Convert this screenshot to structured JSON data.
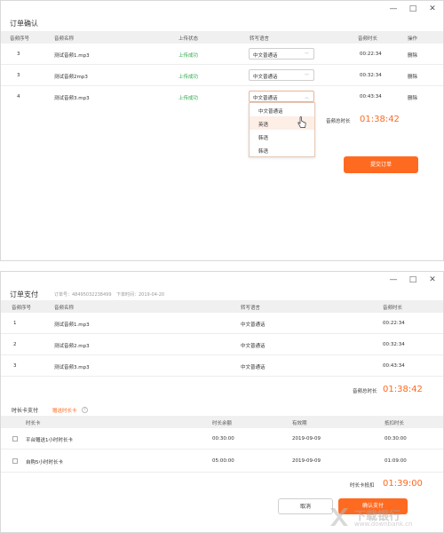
{
  "window_controls": {
    "minimize": "—",
    "maximize": "□",
    "close": "✕"
  },
  "order_confirm": {
    "title": "订单确认",
    "headers": [
      "音频序号",
      "音频名称",
      "上传状态",
      "转写语言",
      "音频时长",
      "操作"
    ],
    "rows": [
      {
        "index": "3",
        "name": "测试音频1.mp3",
        "status": "上传成功",
        "language": "中文普通话",
        "duration": "00:22:34",
        "action": "删除"
      },
      {
        "index": "3",
        "name": "测试音频2mp3",
        "status": "上传成功",
        "language": "中文普通话",
        "duration": "00:32:34",
        "action": "删除"
      },
      {
        "index": "4",
        "name": "测试音频3.mp3",
        "status": "上传成功",
        "language": "中文普通话",
        "duration": "00:43:34",
        "action": "删除"
      }
    ],
    "dropdown_options": [
      "中文普通话",
      "英语",
      "韩语",
      "韩语"
    ],
    "highlighted_option": 1,
    "total_label": "音频总时长",
    "total_value": "01:38:42",
    "submit_label": "提交订单"
  },
  "order_pay": {
    "title": "订单支付",
    "order_no": "订单号：48495032238499",
    "order_time": "下单时间：2019-04-20",
    "headers": [
      "音频序号",
      "音频名称",
      "转写语言",
      "音频时长"
    ],
    "rows": [
      {
        "index": "1",
        "name": "测试音频1.mp3",
        "language": "中文普通话",
        "duration": "00:22:34"
      },
      {
        "index": "2",
        "name": "测试音频2.mp3",
        "language": "中文普通话",
        "duration": "00:32:34"
      },
      {
        "index": "3",
        "name": "测试音频3.mp3",
        "language": "中文普通话",
        "duration": "00:43:34"
      }
    ],
    "total_label": "音频总时长",
    "total_value": "01:38:42",
    "card_section_label": "时长卡支付",
    "card_link": "赠送时长卡",
    "help_icon": "?",
    "card_headers": [
      "时长卡",
      "时长余额",
      "有效期",
      "抵扣时长"
    ],
    "cards": [
      {
        "name": "平台赠送1小时时长卡",
        "balance": "00:30:00",
        "expiry": "2019-09-09",
        "deduct": "00:30:00"
      },
      {
        "name": "自购5小时时长卡",
        "balance": "05:00:00",
        "expiry": "2019-09-09",
        "deduct": "01:09:00"
      }
    ],
    "deduct_label": "时长卡抵扣",
    "deduct_value": "01:39:00",
    "cancel_label": "取消",
    "confirm_label": "确认支付"
  },
  "watermark": {
    "cn": "下载银行",
    "en": "www.downbank.cn"
  }
}
